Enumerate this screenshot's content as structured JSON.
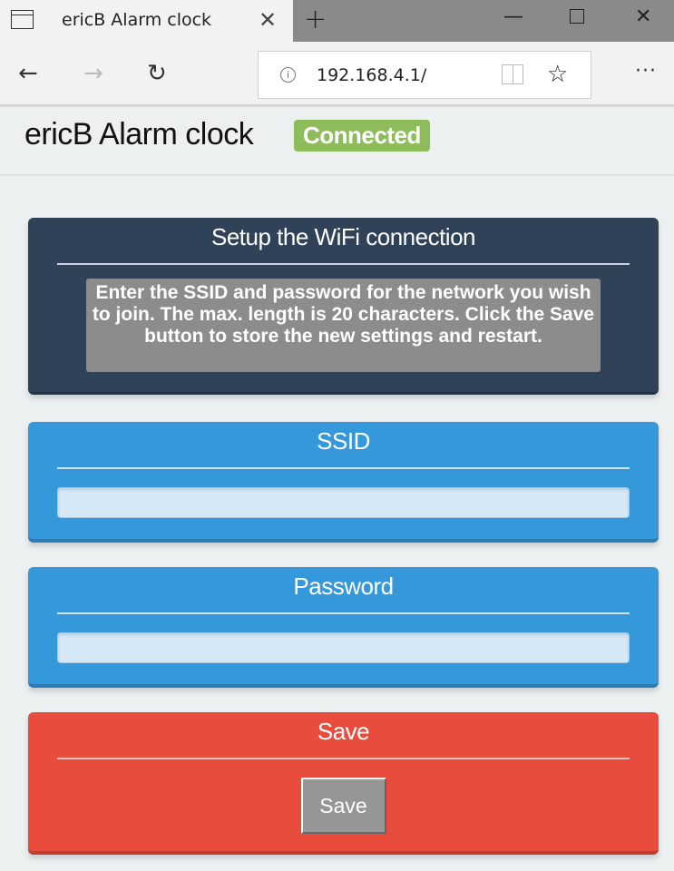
{
  "browser": {
    "tab_title": "ericB Alarm clock",
    "tab_close_glyph": "✕",
    "new_tab_glyph": "+",
    "minimize_glyph": "—",
    "close_glyph": "✕",
    "back_glyph": "←",
    "forward_glyph": "→",
    "refresh_glyph": "↻",
    "info_glyph": "i",
    "url": "192.168.4.1/",
    "favorite_glyph": "☆",
    "more_glyph": "···"
  },
  "header": {
    "title": "ericB Alarm clock",
    "status_badge": "Connected",
    "status_color": "#8fbc5a"
  },
  "wifi_card": {
    "title": "Setup the WiFi connection",
    "info_text": "Enter the SSID and password for the network you wish to join. The max. length is 20 characters. Click the Save button to store the new settings and restart."
  },
  "ssid_card": {
    "title": "SSID",
    "input_value": "",
    "input_placeholder": ""
  },
  "password_card": {
    "title": "Password",
    "input_value": "",
    "input_placeholder": ""
  },
  "save_card": {
    "title": "Save",
    "button_label": "Save"
  },
  "colors": {
    "dark_card": "#2f4257",
    "blue_card": "#3498db",
    "red_card": "#e74c3c",
    "page_bg": "#ecf0f1"
  }
}
